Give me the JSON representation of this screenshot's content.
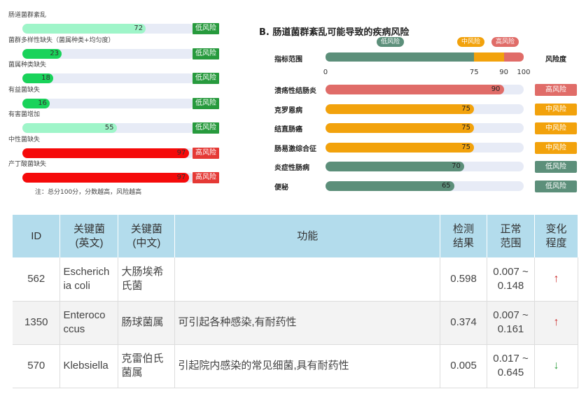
{
  "colors": {
    "low_green_badge": "#279a3d",
    "high_red_badge": "#e53935",
    "track": "#e7ebf6",
    "teal": "#5c8f7a",
    "orange": "#f2a20c",
    "salmon": "#e06c68",
    "table_header": "#b3dcec"
  },
  "left_panel": {
    "note": "注：总分100分，分数越高，风险越高",
    "items": [
      {
        "label": "肠道菌群紊乱",
        "value": 72,
        "badge": "低风险",
        "fill": "#9ff5c9",
        "badge_color": "#279a3d"
      },
      {
        "label": "菌群多样性缺失（菌属种类+均匀度）",
        "value": 23,
        "badge": "低风险",
        "fill": "#19d35a",
        "badge_color": "#279a3d"
      },
      {
        "label": "菌属种类缺失",
        "value": 18,
        "badge": "低风险",
        "fill": "#19d35a",
        "badge_color": "#279a3d"
      },
      {
        "label": "有益菌缺失",
        "value": 16,
        "badge": "低风险",
        "fill": "#19d35a",
        "badge_color": "#279a3d"
      },
      {
        "label": "有害菌增加",
        "value": 55,
        "badge": "低风险",
        "fill": "#9ff5c9",
        "badge_color": "#279a3d"
      },
      {
        "label": "中性菌缺失",
        "value": 97,
        "badge": "高风险",
        "fill": "#f50a0a",
        "badge_color": "#e53935"
      },
      {
        "label": "产丁酸菌缺失",
        "value": 97,
        "badge": "高风险",
        "fill": "#f50a0a",
        "badge_color": "#e53935"
      }
    ]
  },
  "chart_data": {
    "type": "bar",
    "title": "B. 肠道菌群紊乱可能导致的疾病风险",
    "legend": [
      {
        "label": "低风险",
        "color": "#5c8f7a"
      },
      {
        "label": "中风险",
        "color": "#f2a20c"
      },
      {
        "label": "高风险",
        "color": "#e06c68"
      }
    ],
    "scale_row_label": "指标范围",
    "risk_header": "风险度",
    "scale_segments": [
      {
        "from": 0,
        "to": 75,
        "color": "#5c8f7a"
      },
      {
        "from": 75,
        "to": 90,
        "color": "#f2a20c"
      },
      {
        "from": 90,
        "to": 100,
        "color": "#e06c68"
      }
    ],
    "ticks": [
      "0",
      "75",
      "90",
      "100"
    ],
    "xlim": [
      0,
      100
    ],
    "categories": [
      "溃疡性结肠炎",
      "克罗恩病",
      "结直肠癌",
      "肠易激综合征",
      "炎症性肠病",
      "便秘"
    ],
    "values": [
      90,
      75,
      75,
      75,
      70,
      65
    ],
    "risk_levels": [
      "高风险",
      "中风险",
      "中风险",
      "中风险",
      "低风险",
      "低风险"
    ],
    "bar_colors": [
      "#e06c68",
      "#f2a20c",
      "#f2a20c",
      "#f2a20c",
      "#5c8f7a",
      "#5c8f7a"
    ]
  },
  "table": {
    "headers": [
      "ID",
      "关键菌\n(英文)",
      "关键菌\n(中文)",
      "功能",
      "检测\n结果",
      "正常\n范围",
      "变化\n程度"
    ],
    "rows": [
      {
        "id": "562",
        "en": "Escherich ia coli",
        "cn": "大肠埃希 氏菌",
        "func": "",
        "result": "0.598",
        "range": "0.007 ~ 0.148",
        "change": "↑",
        "dir": "up"
      },
      {
        "id": "1350",
        "en": "Enteroco ccus",
        "cn": "肠球菌属",
        "func": "可引起各种感染,有耐药性",
        "result": "0.374",
        "range": "0.007 ~ 0.161",
        "change": "↑",
        "dir": "up"
      },
      {
        "id": "570",
        "en": "Klebsiella",
        "cn": "克雷伯氏 菌属",
        "func": "引起院内感染的常见细菌,具有耐药性",
        "result": "0.005",
        "range": "0.017 ~ 0.645",
        "change": "↓",
        "dir": "down"
      }
    ]
  }
}
